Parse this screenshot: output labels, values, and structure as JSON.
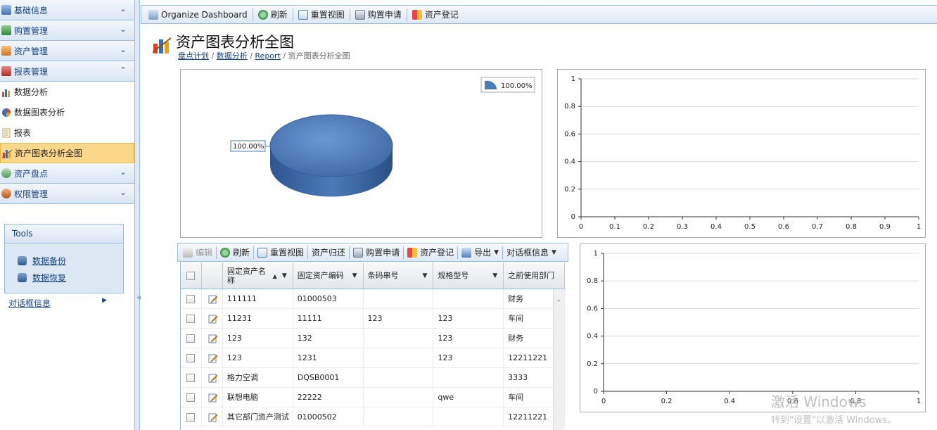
{
  "sidebar": {
    "groups": [
      {
        "label": "基础信息",
        "icon": "table-icon",
        "expanded": false
      },
      {
        "label": "购置管理",
        "icon": "purchase-icon",
        "expanded": false
      },
      {
        "label": "资产管理",
        "icon": "asset-icon",
        "expanded": false
      },
      {
        "label": "报表管理",
        "icon": "report-icon",
        "expanded": true
      },
      {
        "label": "资产盘点",
        "icon": "inventory-icon",
        "expanded": false
      },
      {
        "label": "权限管理",
        "icon": "users-icon",
        "expanded": false
      }
    ],
    "report_items": [
      {
        "label": "数据分析",
        "icon": "bar-chart-icon"
      },
      {
        "label": "数据图表分析",
        "icon": "pie-chart-icon"
      },
      {
        "label": "报表",
        "icon": "document-icon"
      },
      {
        "label": "资产图表分析全图",
        "icon": "chart-mix-icon",
        "active": true
      }
    ],
    "tools": {
      "title": "Tools",
      "links": [
        "数据备份",
        "数据恢复"
      ]
    },
    "dialog_info": "对话框信息"
  },
  "topbar": {
    "buttons": [
      "Organize Dashboard",
      "刷新",
      "重置视图",
      "购置申请",
      "资产登记"
    ]
  },
  "page": {
    "title": "资产图表分析全图",
    "breadcrumb": [
      "盘点计划",
      "数据分析",
      "Report"
    ],
    "breadcrumb_current": "资产图表分析全图"
  },
  "grid_toolbar": {
    "buttons": [
      "编辑",
      "刷新",
      "重置视图",
      "资产归还",
      "购置申请",
      "资产登记",
      "导出",
      "对话框信息"
    ]
  },
  "grid": {
    "columns": [
      "固定资产名称",
      "固定资产编码",
      "条码串号",
      "规格型号",
      "之前使用部门"
    ],
    "rows": [
      [
        "111111",
        "01000503",
        "",
        "",
        "财务"
      ],
      [
        "11231",
        "11111",
        "123",
        "123",
        "车间"
      ],
      [
        "123",
        "132",
        "",
        "123",
        "财务"
      ],
      [
        "123",
        "1231",
        "",
        "123",
        "12211221"
      ],
      [
        "格力空调",
        "DQSB0001",
        "",
        "",
        "3333"
      ],
      [
        "联想电脑",
        "22222",
        "",
        "qwe",
        "车间"
      ],
      [
        "其它部门资产测试",
        "01000502",
        "",
        "",
        "12211221"
      ]
    ]
  },
  "chart_data": [
    {
      "type": "pie",
      "values": [
        100
      ],
      "data_labels": [
        "100.00%"
      ],
      "legend": [
        "100.00%"
      ],
      "legend_position": "top-right",
      "style": "3d",
      "color": "#4a7ab8"
    },
    {
      "type": "line",
      "xlim": [
        0,
        1
      ],
      "ylim": [
        0,
        1
      ],
      "xticks": [
        "0",
        "0.1",
        "0.2",
        "0.3",
        "0.4",
        "0.5",
        "0.6",
        "0.7",
        "0.8",
        "0.9",
        "1"
      ],
      "yticks": [
        "0",
        "0.2",
        "0.4",
        "0.6",
        "0.8",
        "1"
      ],
      "series": [],
      "grid": true
    },
    {
      "type": "line",
      "xlim": [
        0,
        1
      ],
      "ylim": [
        0,
        1
      ],
      "xticks": [
        "0",
        "0.2",
        "0.4",
        "0.6",
        "0.8",
        "1"
      ],
      "yticks": [
        "0",
        "0.2",
        "0.4",
        "0.6",
        "0.8",
        "1"
      ],
      "series": [],
      "grid": true
    }
  ],
  "watermark": {
    "line1": "激活 Windows",
    "line2": "转到\"设置\"以激活 Windows。"
  },
  "colors": {
    "accent": "#15428b",
    "border": "#99bbe8",
    "active": "#fdd88a"
  }
}
